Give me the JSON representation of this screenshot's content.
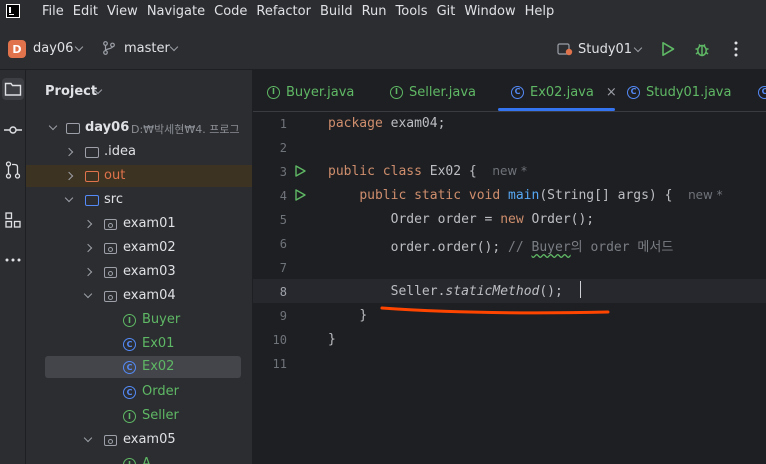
{
  "menu": [
    "File",
    "Edit",
    "View",
    "Navigate",
    "Code",
    "Refactor",
    "Build",
    "Run",
    "Tools",
    "Git",
    "Window",
    "Help"
  ],
  "toolbar": {
    "project_initial": "D",
    "project_name": "day06",
    "branch": "master",
    "run_config": "Study01"
  },
  "panel": {
    "title": "Project",
    "root_name": "day06",
    "root_path": "D:₩박세현₩4. 프로그",
    "items": {
      "idea": ".idea",
      "out": "out",
      "src": "src",
      "exam01": "exam01",
      "exam02": "exam02",
      "exam03": "exam03",
      "exam04": "exam04",
      "buyer": "Buyer",
      "ex01": "Ex01",
      "ex02": "Ex02",
      "order": "Order",
      "seller": "Seller",
      "exam05": "exam05",
      "a": "A"
    }
  },
  "tabs": [
    "Buyer.java",
    "Seller.java",
    "Ex02.java",
    "Study01.java"
  ],
  "editor": {
    "line_numbers": [
      "1",
      "2",
      "3",
      "4",
      "5",
      "6",
      "7",
      "8",
      "9",
      "10",
      "11"
    ],
    "current_line": "8",
    "hint_new": "new *",
    "code": {
      "l1_kw": "package",
      "l1_rest": " exam04;",
      "l3_kw": "public class",
      "l3_rest": " Ex02 {",
      "l4_kw": "public static void",
      "l4_fn": "main",
      "l4_rest": "(String[] args) {",
      "l5_a": "Order order = ",
      "l5_kw": "new",
      "l5_b": " Order();",
      "l6_a": "order.order(); ",
      "l6_cm1": "// ",
      "l6_cm2": "Buyer",
      "l6_cm3": "의 order 메서드",
      "l8_a": "Seller.",
      "l8_sm": "staticMethod",
      "l8_b": "();",
      "l9": "}",
      "l10": "}"
    }
  },
  "colors": {
    "accent": "#3574f0",
    "keyword": "#cf8e6d",
    "function": "#56a8f5",
    "annotation": "#ff4500",
    "run_green": "#5fb865"
  }
}
